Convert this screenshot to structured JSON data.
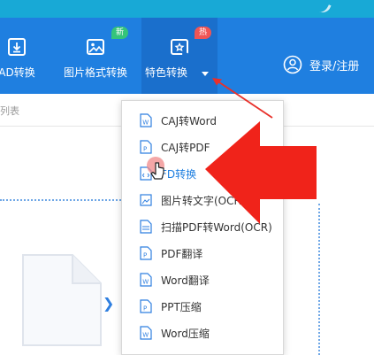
{
  "colors": {
    "header": "#1f7fe0",
    "active_tab": "#1a6fcc",
    "badge_new": "#35c47a",
    "badge_hot": "#f05555",
    "arrow": "#f0231a",
    "accent_text": "#1f7fe0"
  },
  "nav": {
    "items": [
      {
        "label": "AD转换",
        "icon": "download-file-icon"
      },
      {
        "label": "图片格式转换",
        "icon": "image-icon",
        "badge": "新"
      },
      {
        "label": "特色转换",
        "icon": "refresh-star-icon",
        "badge": "热"
      }
    ],
    "login_label": "登录/注册",
    "login_icon": "user-icon"
  },
  "sub_label": "列表",
  "menu": {
    "items": [
      {
        "label": "CAJ转Word",
        "icon": "file-w-icon"
      },
      {
        "label": "CAJ转PDF",
        "icon": "file-p-icon"
      },
      {
        "label": "PDF转换",
        "visible_label": "FD转换",
        "icon": "file-code-icon",
        "active": true
      },
      {
        "label": "图片转文字(OCR)",
        "visible_label": "图片转文字(OCR",
        "icon": "image-icon"
      },
      {
        "label": "扫描PDF转Word(OCR)",
        "icon": "scan-icon"
      },
      {
        "label": "PDF翻译",
        "icon": "file-p-icon"
      },
      {
        "label": "Word翻译",
        "icon": "file-w-icon"
      },
      {
        "label": "PPT压缩",
        "icon": "file-p-icon"
      },
      {
        "label": "Word压缩",
        "icon": "file-w-icon"
      }
    ]
  }
}
